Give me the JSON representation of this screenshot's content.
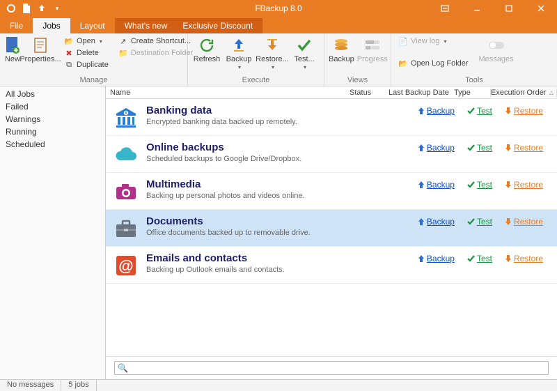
{
  "app": {
    "title": "FBackup 8.0"
  },
  "tabs": {
    "file": "File",
    "jobs": "Jobs",
    "layout": "Layout",
    "whatsnew": "What's new",
    "discount": "Exclusive Discount"
  },
  "ribbon": {
    "new": "New",
    "properties": "Properties...",
    "open": "Open",
    "delete": "Delete",
    "duplicate": "Duplicate",
    "create_shortcut": "Create Shortcut...",
    "destination_folder": "Destination Folder",
    "refresh": "Refresh",
    "backup": "Backup",
    "restore": "Restore...",
    "test": "Test...",
    "backup2": "Backup",
    "progress": "Progress",
    "view_log": "View log",
    "open_log_folder": "Open Log Folder",
    "messages": "Messages",
    "group_manage": "Manage",
    "group_execute": "Execute",
    "group_views": "Views",
    "group_tools": "Tools"
  },
  "filters": [
    "All Jobs",
    "Failed",
    "Warnings",
    "Running",
    "Scheduled"
  ],
  "columns": {
    "name": "Name",
    "status": "Status",
    "last_backup": "Last Backup Date",
    "type": "Type",
    "exec_order": "Execution Order"
  },
  "action_labels": {
    "backup": "Backup",
    "test": "Test",
    "restore": "Restore"
  },
  "jobs": [
    {
      "name": "Banking data",
      "desc": "Encrypted banking data backed up remotely.",
      "icon": "bank",
      "color": "#2a7dd1"
    },
    {
      "name": "Online backups",
      "desc": "Scheduled backups to Google Drive/Dropbox.",
      "icon": "cloud",
      "color": "#35b7c9"
    },
    {
      "name": "Multimedia",
      "desc": "Backing up personal photos and videos online.",
      "icon": "camera",
      "color": "#b0308b"
    },
    {
      "name": "Documents",
      "desc": "Office documents backed up to removable drive.",
      "icon": "briefcase",
      "color": "#6a7480",
      "selected": true
    },
    {
      "name": "Emails and contacts",
      "desc": "Backing up Outlook emails and contacts.",
      "icon": "at",
      "color": "#e24a2b"
    }
  ],
  "search": {
    "placeholder": ""
  },
  "status": {
    "messages": "No messages",
    "jobs": "5 jobs"
  }
}
